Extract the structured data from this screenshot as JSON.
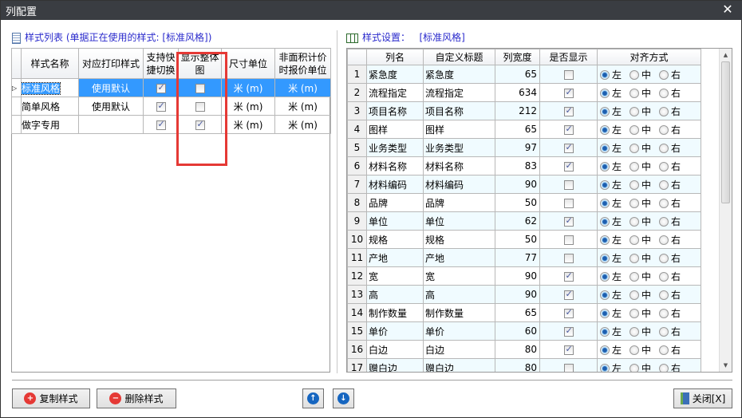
{
  "window": {
    "title": "列配置",
    "close": "✕"
  },
  "left": {
    "title": "样式列表 (单据正在使用的样式: [标准风格])",
    "columns": [
      "样式名称",
      "对应打印样式",
      "支持快捷切换",
      "显示整体图",
      "尺寸单位",
      "非面积计价时报价单位"
    ],
    "rows": [
      {
        "name": "标准风格",
        "print": "使用默认",
        "quick": true,
        "whole": false,
        "unit": "米 (m)",
        "price_unit": "米 (m)",
        "selected": true
      },
      {
        "name": "简单风格",
        "print": "使用默认",
        "quick": true,
        "whole": false,
        "unit": "米 (m)",
        "price_unit": "米 (m)"
      },
      {
        "name": "做字专用",
        "print": "",
        "quick": true,
        "whole": true,
        "unit": "米 (m)",
        "price_unit": "米 (m)"
      }
    ]
  },
  "right": {
    "title": "样式设置：",
    "style": "[标准风格]",
    "columns": [
      "列名",
      "自定义标题",
      "列宽度",
      "是否显示",
      "对齐方式"
    ],
    "align_options": [
      "左",
      "中",
      "右"
    ],
    "rows": [
      [
        "紧急度",
        "紧急度",
        65,
        false
      ],
      [
        "流程指定",
        "流程指定",
        634,
        true
      ],
      [
        "项目名称",
        "项目名称",
        212,
        true
      ],
      [
        "图样",
        "图样",
        65,
        true
      ],
      [
        "业务类型",
        "业务类型",
        97,
        true
      ],
      [
        "材料名称",
        "材料名称",
        83,
        true
      ],
      [
        "材料编码",
        "材料编码",
        90,
        false
      ],
      [
        "品牌",
        "品牌",
        50,
        false
      ],
      [
        "单位",
        "单位",
        62,
        true
      ],
      [
        "规格",
        "规格",
        50,
        false
      ],
      [
        "产地",
        "产地",
        77,
        false
      ],
      [
        "宽",
        "宽",
        90,
        true
      ],
      [
        "高",
        "高",
        90,
        true
      ],
      [
        "制作数量",
        "制作数量",
        65,
        true
      ],
      [
        "单价",
        "单价",
        60,
        true
      ],
      [
        "白边",
        "白边",
        80,
        true
      ],
      [
        "赠白边",
        "赠白边",
        80,
        false
      ]
    ],
    "alignment": "左"
  },
  "buttons": {
    "copy": "复制样式",
    "delete": "删除样式",
    "close": "关闭[X]"
  },
  "colors": {
    "highlight": "#3399ff",
    "section_title": "#2a2acc",
    "annotation": "#e53935"
  }
}
